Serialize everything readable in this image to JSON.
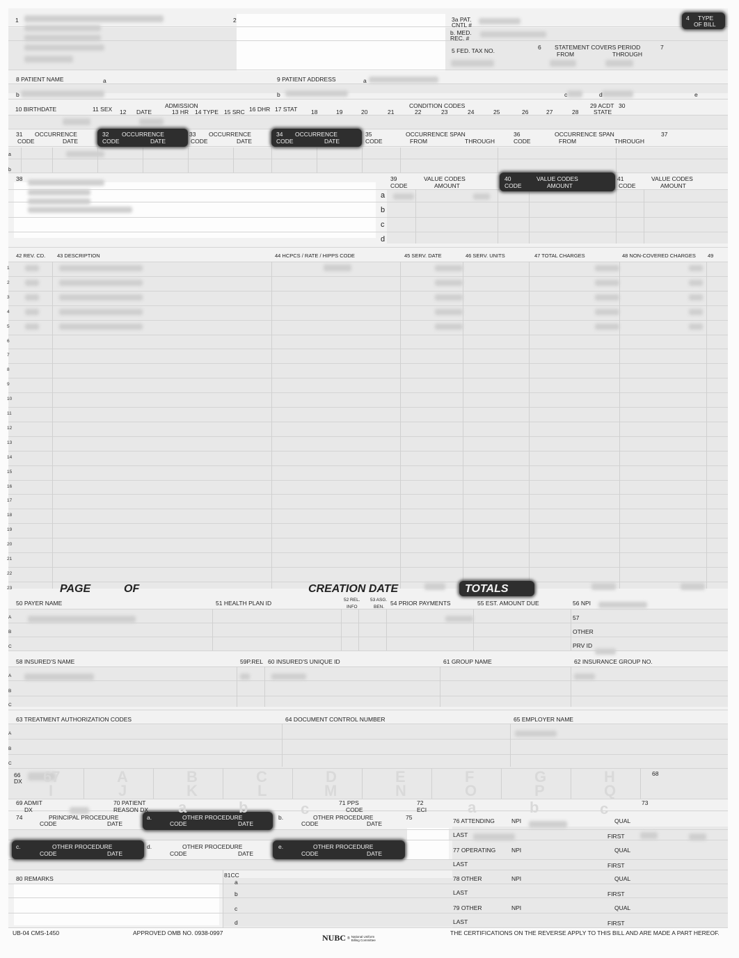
{
  "header": {
    "labels": [
      "1",
      "2",
      "3a PAT.",
      "CNTL #",
      "b. MED.",
      "REC. #",
      "4",
      "TYPE",
      "OF BILL",
      "5 FED. TAX NO.",
      "6",
      "STATEMENT COVERS PERIOD",
      "FROM",
      "THROUGH",
      "7"
    ]
  },
  "patient": {
    "labels": [
      "8 PATIENT NAME",
      "a",
      "b",
      "9 PATIENT ADDRESS",
      "a",
      "b",
      "c",
      "d",
      "e"
    ]
  },
  "admission": {
    "labels": [
      "10 BIRTHDATE",
      "11 SEX",
      "12",
      "DATE",
      "ADMISSION",
      "13 HR",
      "14 TYPE",
      "15 SRC",
      "16 DHR",
      "17 STAT",
      "18",
      "19",
      "20",
      "21",
      "22",
      "23",
      "24",
      "25",
      "26",
      "27",
      "28",
      "CONDITION CODES",
      "29 ACDT",
      "STATE",
      "30"
    ]
  },
  "occurrence": {
    "labels": [
      "31",
      "OCCURRENCE",
      "CODE",
      "DATE",
      "32",
      "OCCURRENCE",
      "CODE",
      "DATE",
      "33",
      "OCCURRENCE",
      "CODE",
      "DATE",
      "34",
      "OCCURRENCE",
      "CODE",
      "DATE",
      "35",
      "CODE",
      "OCCURRENCE SPAN",
      "FROM",
      "THROUGH",
      "36",
      "CODE",
      "OCCURRENCE SPAN",
      "FROM",
      "THROUGH",
      "37",
      "a",
      "b",
      "38"
    ]
  },
  "value_codes": {
    "labels": [
      "39",
      "CODE",
      "VALUE CODES",
      "AMOUNT",
      "40",
      "CODE",
      "VALUE CODES",
      "AMOUNT",
      "41",
      "CODE",
      "VALUE CODES",
      "AMOUNT",
      "a",
      "b",
      "c",
      "d"
    ]
  },
  "service_lines": {
    "headers": [
      "42 REV. CD.",
      "43 DESCRIPTION",
      "44 HCPCS / RATE / HIPPS CODE",
      "45 SERV. DATE",
      "46 SERV. UNITS",
      "47 TOTAL CHARGES",
      "48 NON-COVERED CHARGES",
      "49"
    ],
    "line_numbers": [
      "1",
      "2",
      "3",
      "4",
      "5",
      "6",
      "7",
      "8",
      "9",
      "10",
      "11",
      "12",
      "13",
      "14",
      "15",
      "16",
      "17",
      "18",
      "19",
      "20",
      "21",
      "22",
      "23"
    ],
    "totals_row": [
      "PAGE",
      "OF",
      "CREATION DATE",
      "TOTALS"
    ]
  },
  "payer": {
    "labels": [
      "50 PAYER NAME",
      "51 HEALTH PLAN ID",
      "52 REL.",
      "INFO",
      "53 ASG.",
      "BEN.",
      "54 PRIOR PAYMENTS",
      "55 EST. AMOUNT DUE",
      "56 NPI",
      "57",
      "OTHER",
      "PRV ID",
      "A",
      "B",
      "C"
    ]
  },
  "insured": {
    "labels": [
      "58 INSURED'S NAME",
      "59P.REL",
      "60 INSURED'S UNIQUE ID",
      "61 GROUP NAME",
      "62 INSURANCE GROUP NO.",
      "A",
      "B",
      "C"
    ]
  },
  "authorization": {
    "labels": [
      "63 TREATMENT AUTHORIZATION CODES",
      "64 DOCUMENT CONTROL NUMBER",
      "65 EMPLOYER NAME",
      "A",
      "B",
      "C"
    ]
  },
  "diagnosis": {
    "labels": [
      "66",
      "DX",
      "67",
      "A",
      "B",
      "C",
      "D",
      "E",
      "F",
      "G",
      "H",
      "I",
      "J",
      "K",
      "L",
      "M",
      "N",
      "O",
      "P",
      "Q",
      "68",
      "69 ADMIT",
      "DX",
      "70 PATIENT",
      "REASON DX",
      "a",
      "b",
      "c",
      "71 PPS",
      "CODE",
      "72",
      "ECI",
      "a",
      "b",
      "c",
      "73"
    ]
  },
  "procedures": {
    "labels": [
      "74",
      "PRINCIPAL PROCEDURE",
      "CODE",
      "DATE",
      "a.",
      "OTHER PROCEDURE",
      "CODE",
      "DATE",
      "b.",
      "OTHER PROCEDURE",
      "CODE",
      "DATE",
      "75",
      "c.",
      "OTHER PROCEDURE",
      "CODE",
      "DATE",
      "d.",
      "OTHER PROCEDURE",
      "CODE",
      "DATE",
      "e.",
      "OTHER PROCEDURE",
      "CODE",
      "DATE"
    ]
  },
  "physicians": {
    "labels": [
      "76 ATTENDING",
      "NPI",
      "QUAL",
      "LAST",
      "FIRST",
      "77 OPERATING",
      "NPI",
      "QUAL",
      "LAST",
      "FIRST",
      "78 OTHER",
      "NPI",
      "QUAL",
      "LAST",
      "FIRST",
      "79 OTHER",
      "NPI",
      "QUAL",
      "LAST",
      "FIRST"
    ]
  },
  "remarks": {
    "labels": [
      "80 REMARKS",
      "81CC",
      "a",
      "b",
      "c",
      "d"
    ]
  },
  "footer": {
    "labels": [
      "UB-04 CMS-1450",
      "APPROVED OMB NO. 0938-0997",
      "THE CERTIFICATIONS ON THE REVERSE APPLY TO THIS BILL AND ARE MADE A PART HEREOF."
    ],
    "logo": {
      "name": "NUBC",
      "mark": "®",
      "line1": "National Uniform",
      "line2": "Billing Committee"
    }
  },
  "colors": {
    "panel": "#f2f2f2",
    "field": "#e8e8e8",
    "highlight_bar": "#2e2e2e"
  }
}
